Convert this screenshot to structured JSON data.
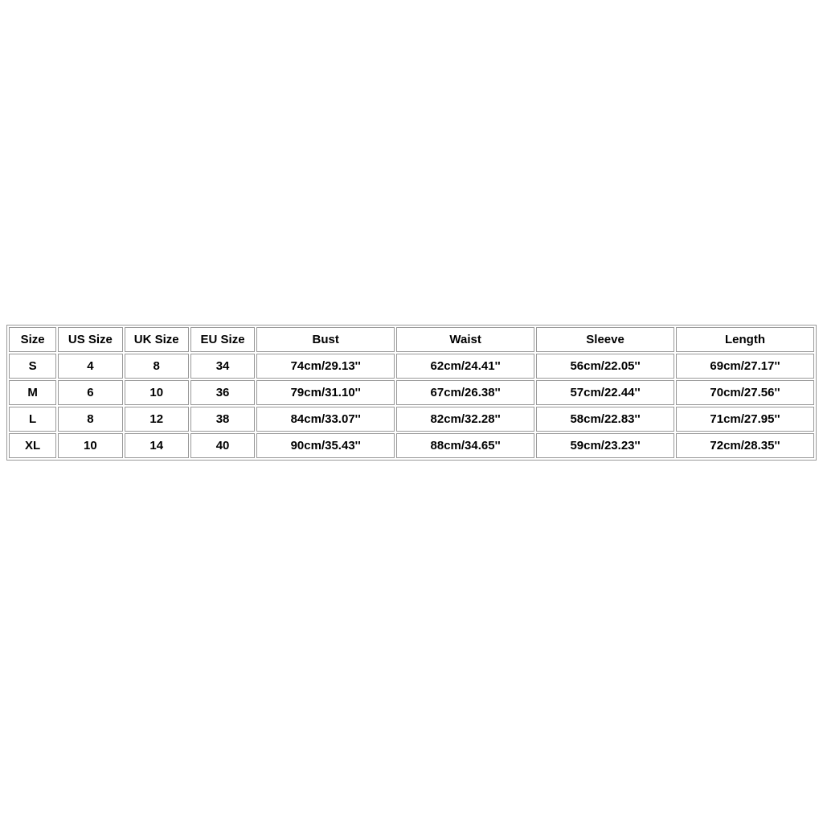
{
  "chart_data": {
    "type": "table",
    "headers": [
      "Size",
      "US Size",
      "UK Size",
      "EU Size",
      "Bust",
      "Waist",
      "Sleeve",
      "Length"
    ],
    "rows": [
      {
        "size": "S",
        "us": "4",
        "uk": "8",
        "eu": "34",
        "bust": "74cm/29.13''",
        "waist": "62cm/24.41''",
        "sleeve": "56cm/22.05''",
        "length": "69cm/27.17''"
      },
      {
        "size": "M",
        "us": "6",
        "uk": "10",
        "eu": "36",
        "bust": "79cm/31.10''",
        "waist": "67cm/26.38''",
        "sleeve": "57cm/22.44''",
        "length": "70cm/27.56''"
      },
      {
        "size": "L",
        "us": "8",
        "uk": "12",
        "eu": "38",
        "bust": "84cm/33.07''",
        "waist": "82cm/32.28''",
        "sleeve": "58cm/22.83''",
        "length": "71cm/27.95''"
      },
      {
        "size": "XL",
        "us": "10",
        "uk": "14",
        "eu": "40",
        "bust": "90cm/35.43''",
        "waist": "88cm/34.65''",
        "sleeve": "59cm/23.23''",
        "length": "72cm/28.35''"
      }
    ]
  }
}
